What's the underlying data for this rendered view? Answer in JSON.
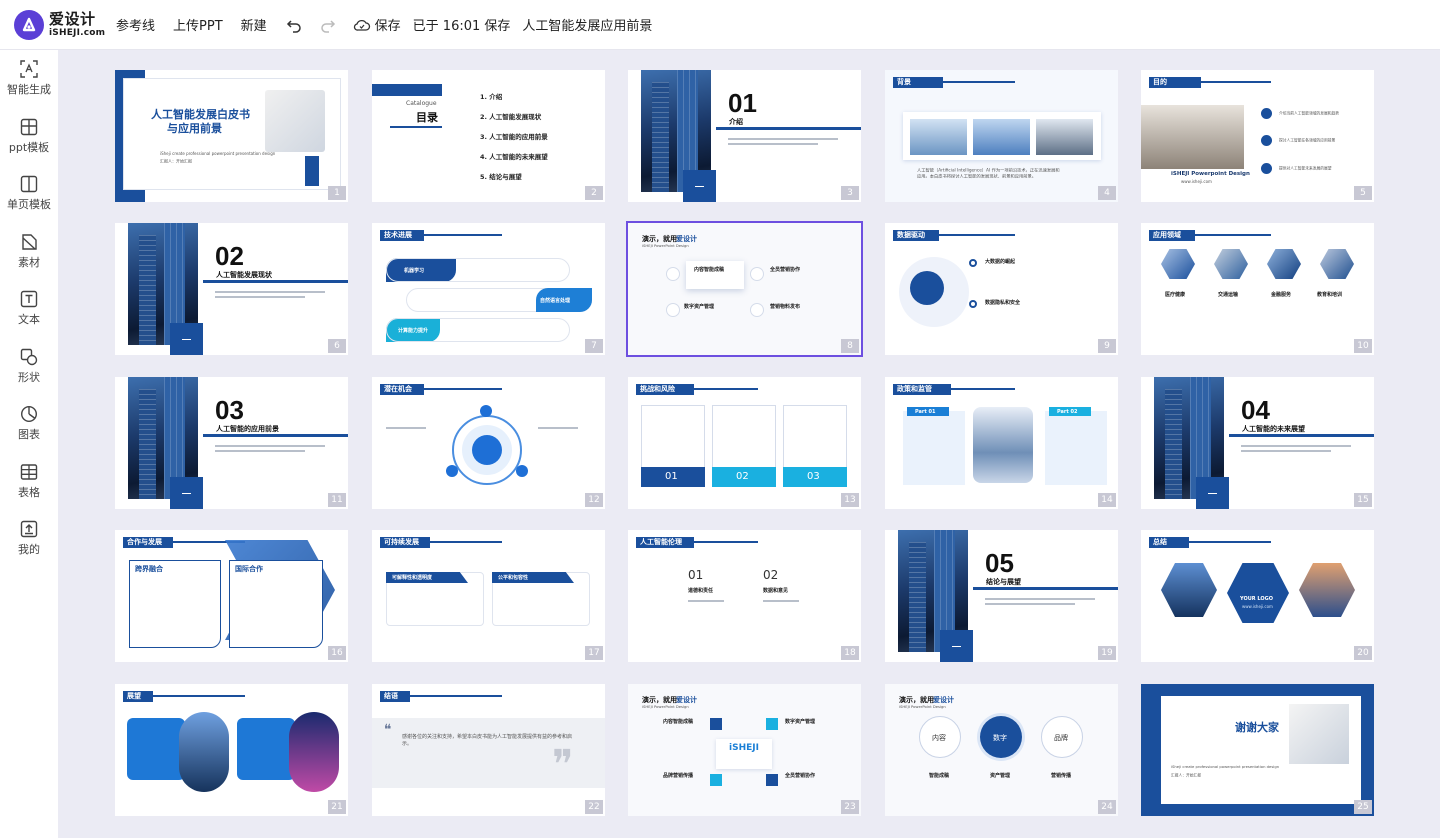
{
  "app": {
    "logo_cn": "爱设计",
    "logo_en": "iSHEJI.com"
  },
  "toolbar": {
    "guides_label": "参考线",
    "upload_label": "上传PPT",
    "new_label": "新建",
    "save_label": "保存",
    "save_status": "已于 16:01 保存",
    "doc_title": "人工智能发展应用前景"
  },
  "sidebar": {
    "items": [
      {
        "label": "智能生成",
        "icon": "ai-generate-icon"
      },
      {
        "label": "ppt模板",
        "icon": "ppt-template-icon"
      },
      {
        "label": "单页模板",
        "icon": "single-page-template-icon"
      },
      {
        "label": "素材",
        "icon": "material-icon"
      },
      {
        "label": "文本",
        "icon": "text-icon"
      },
      {
        "label": "形状",
        "icon": "shape-icon"
      },
      {
        "label": "图表",
        "icon": "chart-icon"
      },
      {
        "label": "表格",
        "icon": "table-icon"
      },
      {
        "label": "我的",
        "icon": "my-upload-icon"
      }
    ]
  },
  "slides": [
    {
      "num": "1",
      "title": "人工智能发展白皮书",
      "title2": "与应用前景",
      "sub": "iSheji create professional powerpoint presentation design",
      "sub2": "汇报人：开始汇报"
    },
    {
      "num": "2",
      "catalogue": "Catalogue",
      "mulu": "目录",
      "items": [
        "1. 介绍",
        "2. 人工智能发展现状",
        "3. 人工智能的应用前景",
        "4. 人工智能的未来展望",
        "5. 结论与展望"
      ]
    },
    {
      "num": "3",
      "big": "01",
      "sub": "介绍"
    },
    {
      "num": "4",
      "header": "背景",
      "text": "人工智能（Artificial Intelligence）AI 作为一项前沿技术，正在迅速发展和应用。本白皮书将探讨人工智能的发展现状、前景和应用前景。"
    },
    {
      "num": "5",
      "header": "目的",
      "brand": "iSHEJI Powerpoint Design",
      "url": "www.isheji.com",
      "points": [
        "介绍当前人工智能领域的发展和趋势",
        "探讨人工智能在各领域的应用前景",
        "提供对人工智能未来发展的展望"
      ]
    },
    {
      "num": "6",
      "big": "02",
      "sub": "人工智能发展现状"
    },
    {
      "num": "7",
      "header": "技术进展",
      "labels": [
        "机器学习",
        "自然语言处理",
        "计算能力提升"
      ]
    },
    {
      "num": "8",
      "title_prefix": "演示，就用",
      "title_brand": "爱设计",
      "sub": "iSHEJI PowerPoint Design",
      "items": [
        "内容智能成稿",
        "全员营销协作",
        "数字资产管理",
        "营销物料发布"
      ]
    },
    {
      "num": "9",
      "header": "数据驱动",
      "items": [
        "大数据的崛起",
        "数据隐私和安全"
      ]
    },
    {
      "num": "10",
      "header": "应用领域",
      "items": [
        "医疗健康",
        "交通运输",
        "金融服务",
        "教育和培训"
      ]
    },
    {
      "num": "11",
      "big": "03",
      "sub": "人工智能的应用前景"
    },
    {
      "num": "12",
      "header": "潜在机会"
    },
    {
      "num": "13",
      "header": "挑战和风险",
      "items": [
        "01",
        "02",
        "03"
      ]
    },
    {
      "num": "14",
      "header": "政策和监管",
      "parts": [
        "Part 01",
        "Part 02"
      ]
    },
    {
      "num": "15",
      "big": "04",
      "sub": "人工智能的未来展望"
    },
    {
      "num": "16",
      "header": "合作与发展",
      "boxes": [
        "跨界融合",
        "国际合作"
      ]
    },
    {
      "num": "17",
      "header": "可持续发展",
      "boxes": [
        "可解释性和透明度",
        "公平和包容性"
      ]
    },
    {
      "num": "18",
      "header": "人工智能伦理",
      "nums": [
        "01",
        "02"
      ],
      "labels": [
        "道德和责任",
        "数据和意见"
      ]
    },
    {
      "num": "19",
      "big": "05",
      "sub": "结论与展望"
    },
    {
      "num": "20",
      "header": "总结",
      "logo": "YOUR LOGO",
      "url": "www.isheji.com"
    },
    {
      "num": "21",
      "header": "展望"
    },
    {
      "num": "22",
      "header": "结语",
      "text": "感谢各位的关注和支持，希望本白皮书能为人工智能发展提供有益的参考和启示。"
    },
    {
      "num": "23",
      "title_prefix": "演示，就用",
      "title_brand": "爱设计",
      "sub": "iSHEJI PowerPoint Design",
      "center": "iSHEJI",
      "items": [
        "内容智能成稿",
        "数字资产管理",
        "品牌营销传播",
        "全员营销协作"
      ]
    },
    {
      "num": "24",
      "title_prefix": "演示，就用",
      "title_brand": "爱设计",
      "sub": "iSHEJI PowerPoint Design",
      "circles": [
        "内容",
        "数字",
        "品牌"
      ],
      "labels": [
        "智能成稿",
        "资产管理",
        "营销传播"
      ]
    },
    {
      "num": "25",
      "title": "谢谢大家",
      "sub": "iSheji create professional powerpoint presentation design",
      "sub2": "汇报人：开始汇报"
    }
  ],
  "colors": {
    "accent": "#1a4f9c",
    "selection": "#6d4fe0",
    "logo": "#5b3fd6",
    "canvas_bg": "#ebebf4"
  }
}
